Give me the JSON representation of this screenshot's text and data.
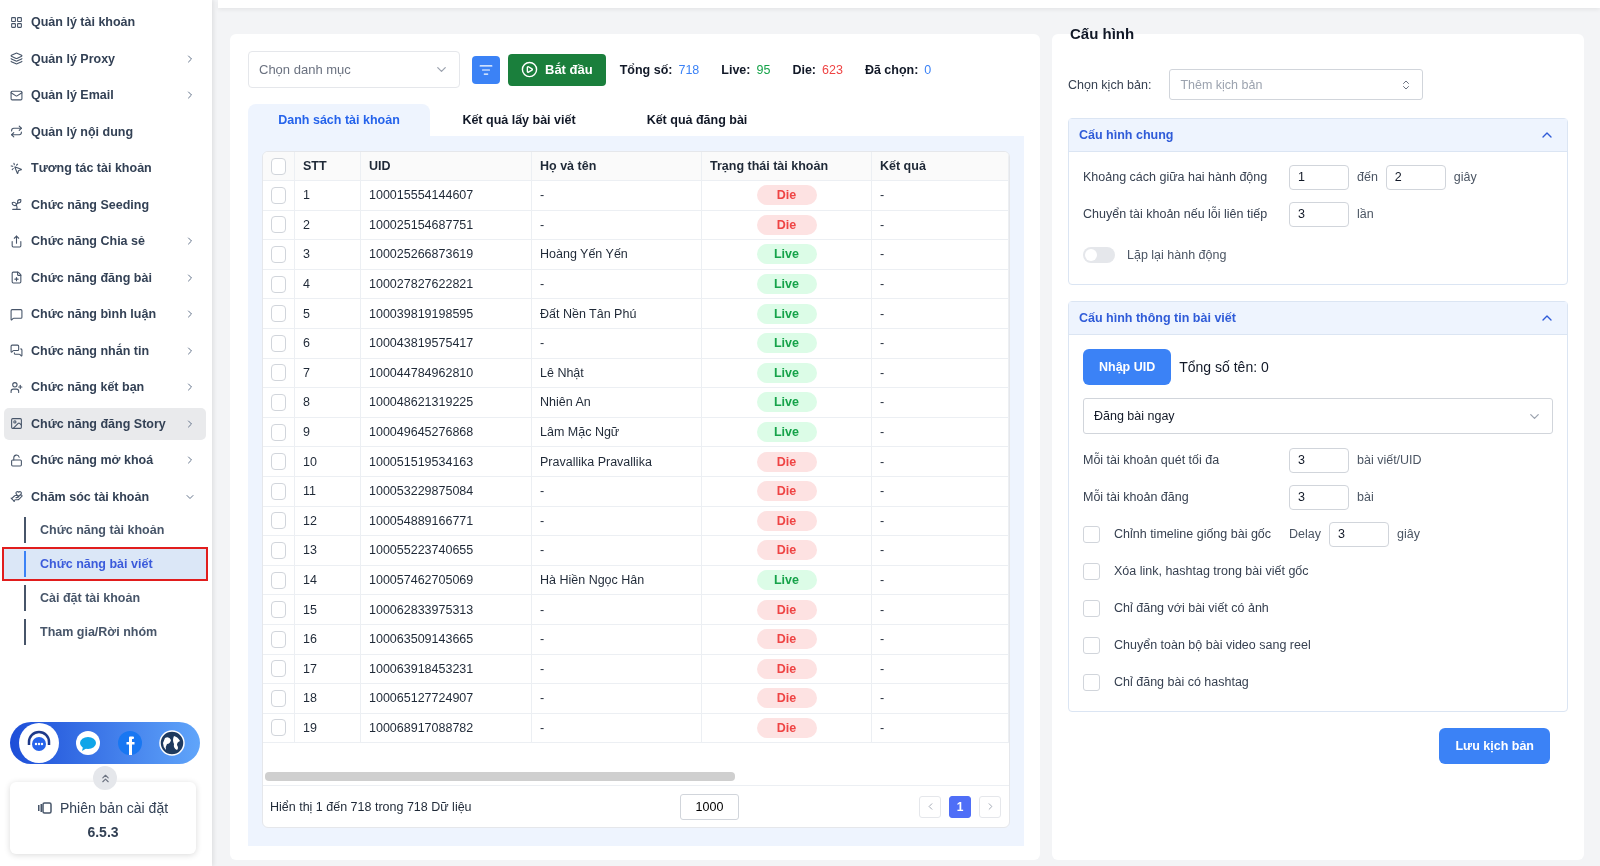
{
  "sidebar": {
    "items": [
      {
        "label": "Quản lý tài khoản",
        "kind": "link",
        "selected": false,
        "highlighted": false
      },
      {
        "label": "Quản lý Proxy",
        "kind": "group",
        "expanded": false,
        "selected": false,
        "highlighted": false
      },
      {
        "label": "Quản lý Email",
        "kind": "group",
        "expanded": false,
        "selected": false,
        "highlighted": false
      },
      {
        "label": "Quản lý nội dung",
        "kind": "link",
        "selected": false,
        "highlighted": false
      },
      {
        "label": "Tương tác tài khoản",
        "kind": "link",
        "selected": false,
        "highlighted": false
      },
      {
        "label": "Chức năng Seeding",
        "kind": "link",
        "selected": false,
        "highlighted": false
      },
      {
        "label": "Chức năng Chia sẻ",
        "kind": "group",
        "expanded": false,
        "selected": false,
        "highlighted": false
      },
      {
        "label": "Chức năng đăng bài",
        "kind": "group",
        "expanded": false,
        "selected": false,
        "highlighted": false
      },
      {
        "label": "Chức năng bình luận",
        "kind": "group",
        "expanded": false,
        "selected": false,
        "highlighted": false
      },
      {
        "label": "Chức năng nhắn tin",
        "kind": "group",
        "expanded": false,
        "selected": false,
        "highlighted": false
      },
      {
        "label": "Chức năng kết bạn",
        "kind": "group",
        "expanded": false,
        "selected": false,
        "highlighted": false
      },
      {
        "label": "Chức năng đăng Story",
        "kind": "group",
        "expanded": false,
        "selected": false,
        "highlighted": true
      },
      {
        "label": "Chức năng mở khoá",
        "kind": "group",
        "expanded": false,
        "selected": false,
        "highlighted": false
      },
      {
        "label": "Chăm sóc tài khoản",
        "kind": "group",
        "expanded": true,
        "selected": false,
        "highlighted": false,
        "children": [
          {
            "label": "Chức năng tài khoản",
            "selected": false,
            "outlined": false
          },
          {
            "label": "Chức năng bài viết",
            "selected": true,
            "outlined": true
          },
          {
            "label": "Cài đặt tài khoản",
            "selected": false,
            "outlined": false
          },
          {
            "label": "Tham gia/Rời nhóm",
            "selected": false,
            "outlined": false
          }
        ]
      }
    ],
    "version_label": "Phiên bản cài đặt",
    "version": "6.5.3"
  },
  "toolbar": {
    "category_placeholder": "Chọn danh mục",
    "start_button": "Bắt đầu",
    "stats": [
      {
        "label": "Tổng số:",
        "value": "718",
        "color": "#3b82f6"
      },
      {
        "label": "Live:",
        "value": "95",
        "color": "#16a34a"
      },
      {
        "label": "Die:",
        "value": "623",
        "color": "#ef4444"
      },
      {
        "label": "Đã chọn:",
        "value": "0",
        "color": "#3b82f6"
      }
    ]
  },
  "tabs": [
    {
      "label": "Danh sách tài khoản",
      "selected": true
    },
    {
      "label": "Kết quả lấy bài viết",
      "selected": false
    },
    {
      "label": "Kết quả đăng bài",
      "selected": false
    }
  ],
  "table": {
    "all_checked": false,
    "columns": [
      "STT",
      "UID",
      "Họ và tên",
      "Trạng thái tài khoản",
      "Kết quả"
    ],
    "rows": [
      {
        "stt": "1",
        "uid": "100015554144607",
        "name": "-",
        "status": "Die",
        "kind": "die",
        "result": "-",
        "checked": false
      },
      {
        "stt": "2",
        "uid": "100025154687751",
        "name": "-",
        "status": "Die",
        "kind": "die",
        "result": "-",
        "checked": false
      },
      {
        "stt": "3",
        "uid": "100025266873619",
        "name": "Hoàng Yến Yến",
        "status": "Live",
        "kind": "live",
        "result": "-",
        "checked": false
      },
      {
        "stt": "4",
        "uid": "100027827622821",
        "name": "-",
        "status": "Live",
        "kind": "live",
        "result": "-",
        "checked": false
      },
      {
        "stt": "5",
        "uid": "100039819198595",
        "name": "Đất Nền Tân Phú",
        "status": "Live",
        "kind": "live",
        "result": "-",
        "checked": false
      },
      {
        "stt": "6",
        "uid": "100043819575417",
        "name": "-",
        "status": "Live",
        "kind": "live",
        "result": "-",
        "checked": false
      },
      {
        "stt": "7",
        "uid": "100044784962810",
        "name": "Lê Nhật",
        "status": "Live",
        "kind": "live",
        "result": "-",
        "checked": false
      },
      {
        "stt": "8",
        "uid": "100048621319225",
        "name": "Nhiên An",
        "status": "Live",
        "kind": "live",
        "result": "-",
        "checked": false
      },
      {
        "stt": "9",
        "uid": "100049645276868",
        "name": "Lâm Mặc Ngữ",
        "status": "Live",
        "kind": "live",
        "result": "-",
        "checked": false
      },
      {
        "stt": "10",
        "uid": "100051519534163",
        "name": "Pravallika Pravallika",
        "status": "Die",
        "kind": "die",
        "result": "-",
        "checked": false
      },
      {
        "stt": "11",
        "uid": "100053229875084",
        "name": "-",
        "status": "Die",
        "kind": "die",
        "result": "-",
        "checked": false
      },
      {
        "stt": "12",
        "uid": "100054889166771",
        "name": "-",
        "status": "Die",
        "kind": "die",
        "result": "-",
        "checked": false
      },
      {
        "stt": "13",
        "uid": "100055223740655",
        "name": "-",
        "status": "Die",
        "kind": "die",
        "result": "-",
        "checked": false
      },
      {
        "stt": "14",
        "uid": "100057462705069",
        "name": "Hà Hiền Ngọc Hân",
        "status": "Live",
        "kind": "live",
        "result": "-",
        "checked": false
      },
      {
        "stt": "15",
        "uid": "100062833975313",
        "name": "-",
        "status": "Die",
        "kind": "die",
        "result": "-",
        "checked": false
      },
      {
        "stt": "16",
        "uid": "100063509143665",
        "name": "-",
        "status": "Die",
        "kind": "die",
        "result": "-",
        "checked": false
      },
      {
        "stt": "17",
        "uid": "100063918453231",
        "name": "-",
        "status": "Die",
        "kind": "die",
        "result": "-",
        "checked": false
      },
      {
        "stt": "18",
        "uid": "100065127724907",
        "name": "-",
        "status": "Die",
        "kind": "die",
        "result": "-",
        "checked": false
      },
      {
        "stt": "19",
        "uid": "100068917088782",
        "name": "-",
        "status": "Die",
        "kind": "die",
        "result": "-",
        "checked": false
      }
    ],
    "summary": "Hiển thị 1 đến 718 trong 718 Dữ liệu",
    "page_size": "1000",
    "pages": [
      {
        "label": "1",
        "selected": true
      }
    ]
  },
  "config": {
    "title": "Cấu hình",
    "script_label": "Chọn kịch bản:",
    "script_placeholder": "Thêm kịch bản",
    "save_button": "Lưu kịch bản",
    "sections": [
      {
        "title": "Cấu hình chung",
        "expanded": true,
        "rows": [
          {
            "kind": "range",
            "label": "Khoảng cách giữa hai hành động",
            "from": "1",
            "between": "đến",
            "to": "2",
            "unit": "giây"
          },
          {
            "kind": "number",
            "label": "Chuyển tài khoản nếu lỗi liên tiếp",
            "value": "3",
            "unit": "lần"
          },
          {
            "kind": "toggle",
            "label": "Lặp lại hành động",
            "on": false
          }
        ]
      },
      {
        "title": "Cấu hình thông tin bài viết",
        "expanded": true,
        "rows": [
          {
            "kind": "uid",
            "button": "Nhập UID",
            "count": "Tổng số tên: 0"
          },
          {
            "kind": "select",
            "value": "Đăng bài ngay"
          },
          {
            "kind": "number",
            "label": "Mỗi tài khoản quét tối đa",
            "value": "3",
            "unit": "bài viết/UID"
          },
          {
            "kind": "number",
            "label": "Mỗi tài khoản đăng",
            "value": "3",
            "unit": "bài"
          },
          {
            "kind": "checkbox",
            "label": "Chỉnh timeline giống bài gốc",
            "checked": false,
            "delay_label": "Delay",
            "delay": "3",
            "unit": "giây"
          },
          {
            "kind": "checkbox",
            "label": "Xóa link, hashtag trong bài viết gốc",
            "checked": false
          },
          {
            "kind": "checkbox",
            "label": "Chỉ đăng với bài viết có ảnh",
            "checked": false
          },
          {
            "kind": "checkbox",
            "label": "Chuyển toàn bộ bài video sang reel",
            "checked": false
          },
          {
            "kind": "checkbox",
            "label": "Chỉ đăng bài có hashtag",
            "checked": false
          }
        ]
      }
    ]
  }
}
